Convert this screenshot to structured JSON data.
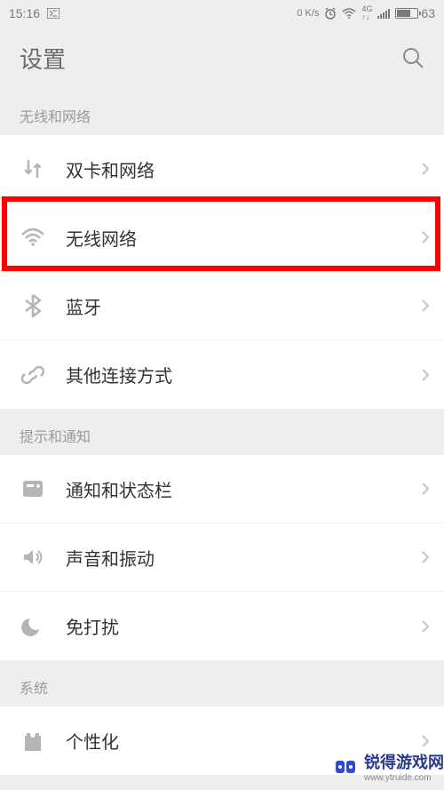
{
  "status_bar": {
    "time": "15:16",
    "net_speed": "0 K/s",
    "battery_pct": "63"
  },
  "header": {
    "title": "设置"
  },
  "sections": [
    {
      "title": "无线和网络",
      "items": [
        {
          "icon": "sim-swap-icon",
          "label": "双卡和网络"
        },
        {
          "icon": "wifi-icon",
          "label": "无线网络",
          "highlighted": true
        },
        {
          "icon": "bluetooth-icon",
          "label": "蓝牙"
        },
        {
          "icon": "link-icon",
          "label": "其他连接方式"
        }
      ]
    },
    {
      "title": "提示和通知",
      "items": [
        {
          "icon": "notification-icon",
          "label": "通知和状态栏"
        },
        {
          "icon": "sound-icon",
          "label": "声音和振动"
        },
        {
          "icon": "dnd-icon",
          "label": "免打扰"
        }
      ]
    },
    {
      "title": "系统",
      "items": [
        {
          "icon": "theme-icon",
          "label": "个性化"
        }
      ]
    }
  ],
  "watermark": {
    "brand": "锐得游戏网",
    "url": "www.ytruide.com"
  }
}
